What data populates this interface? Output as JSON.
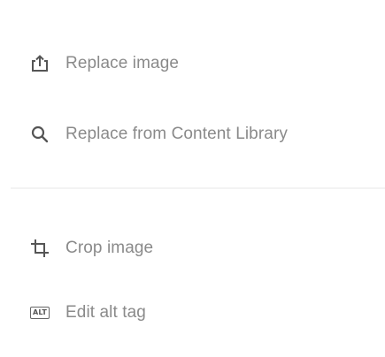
{
  "menu": {
    "items": [
      {
        "label": "Replace image",
        "icon": "upload-icon"
      },
      {
        "label": "Replace from Content Library",
        "icon": "search-icon"
      },
      {
        "label": "Crop image",
        "icon": "crop-icon"
      },
      {
        "label": "Edit alt tag",
        "icon": "alt-tag-icon",
        "badge": "ALT"
      }
    ]
  },
  "colors": {
    "text": "#8a8a8a",
    "icon": "#555555",
    "divider": "#f3f3f3",
    "background": "#ffffff"
  }
}
